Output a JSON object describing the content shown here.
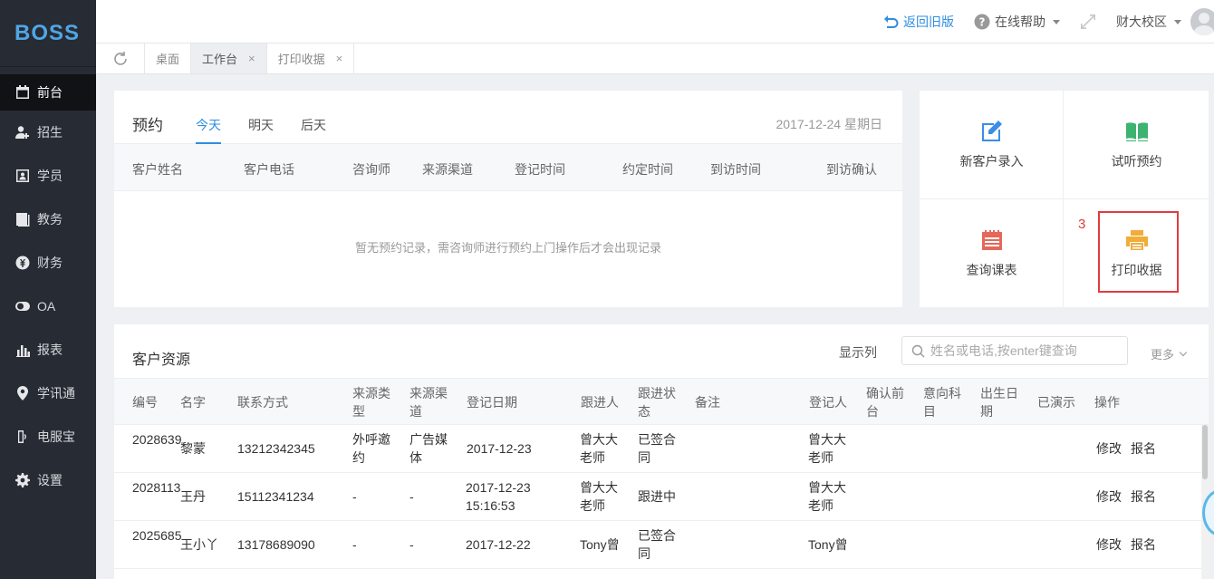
{
  "app": {
    "logo": "BOSS"
  },
  "sidebar": {
    "items": [
      {
        "label": "前台",
        "icon": "calendar-icon",
        "active": true
      },
      {
        "label": "招生",
        "icon": "add-user-icon"
      },
      {
        "label": "学员",
        "icon": "id-card-icon"
      },
      {
        "label": "教务",
        "icon": "book-icon"
      },
      {
        "label": "财务",
        "icon": "yen-icon"
      },
      {
        "label": "OA",
        "icon": "toggle-icon"
      },
      {
        "label": "报表",
        "icon": "bar-chart-icon"
      },
      {
        "label": "学讯通",
        "icon": "location-pin-icon"
      },
      {
        "label": "电服宝",
        "icon": "phone-icon"
      },
      {
        "label": "设置",
        "icon": "gear-icon"
      }
    ]
  },
  "header": {
    "back_label": "返回旧版",
    "help_label": "在线帮助",
    "school_label": "财大校区"
  },
  "page_tabs": [
    {
      "label": "桌面",
      "closable": false
    },
    {
      "label": "工作台",
      "closable": true,
      "active": true
    },
    {
      "label": "打印收据",
      "closable": true
    }
  ],
  "appointments": {
    "title": "预约",
    "day_tabs": [
      "今天",
      "明天",
      "后天"
    ],
    "date": "2017-12-24 星期日",
    "columns": [
      "客户姓名",
      "客户电话",
      "咨询师",
      "来源渠道",
      "登记时间",
      "约定时间",
      "到访时间",
      "到访确认"
    ],
    "empty_text": "暂无预约记录，需咨询师进行预约上门操作后才会出现记录"
  },
  "quick_actions": {
    "items": [
      "新客户录入",
      "试听预约",
      "查询课表",
      "打印收据"
    ],
    "annotation": "3",
    "colors": {
      "edit": "#3a8ee6",
      "book": "#3cb371",
      "calendar": "#e5685c",
      "print": "#f0ad3a"
    }
  },
  "customers": {
    "title": "客户资源",
    "show_columns_label": "显示列",
    "search_placeholder": "姓名或电话,按enter键查询",
    "more_label": "更多",
    "columns": {
      "id": "编号",
      "name": "名字",
      "contact": "联系方式",
      "source_type": "来源类型",
      "source_channel": "来源渠道",
      "reg_date": "登记日期",
      "follower": "跟进人",
      "status": "跟进状态",
      "note": "备注",
      "registrar": "登记人",
      "confirm_front": "确认前台",
      "intent": "意向科目",
      "birth": "出生日期",
      "demo": "已演示",
      "ops": "操作"
    },
    "rows": [
      {
        "id": "2028639",
        "name": "黎蒙",
        "contact": "13212342345",
        "source_type": "外呼邀约",
        "source_channel": "广告媒体",
        "reg_date": "2017-12-23",
        "follower": "曾大大老师",
        "status": "已签合同",
        "note": "",
        "registrar": "曾大大老师",
        "edit": "修改",
        "enroll": "报名"
      },
      {
        "id": "2028113",
        "name": "王丹",
        "contact": "15112341234",
        "source_type": "-",
        "source_channel": "-",
        "reg_date": "2017-12-23 15:16:53",
        "follower": "曾大大老师",
        "status": "跟进中",
        "note": "",
        "registrar": "曾大大老师",
        "edit": "修改",
        "enroll": "报名"
      },
      {
        "id": "2025685",
        "name": "王小丫",
        "contact": "13178689090",
        "source_type": "-",
        "source_channel": "-",
        "reg_date": "2017-12-22",
        "follower": "Tony曾",
        "status": "已签合同",
        "note": "",
        "registrar": "Tony曾",
        "edit": "修改",
        "enroll": "报名"
      }
    ]
  }
}
